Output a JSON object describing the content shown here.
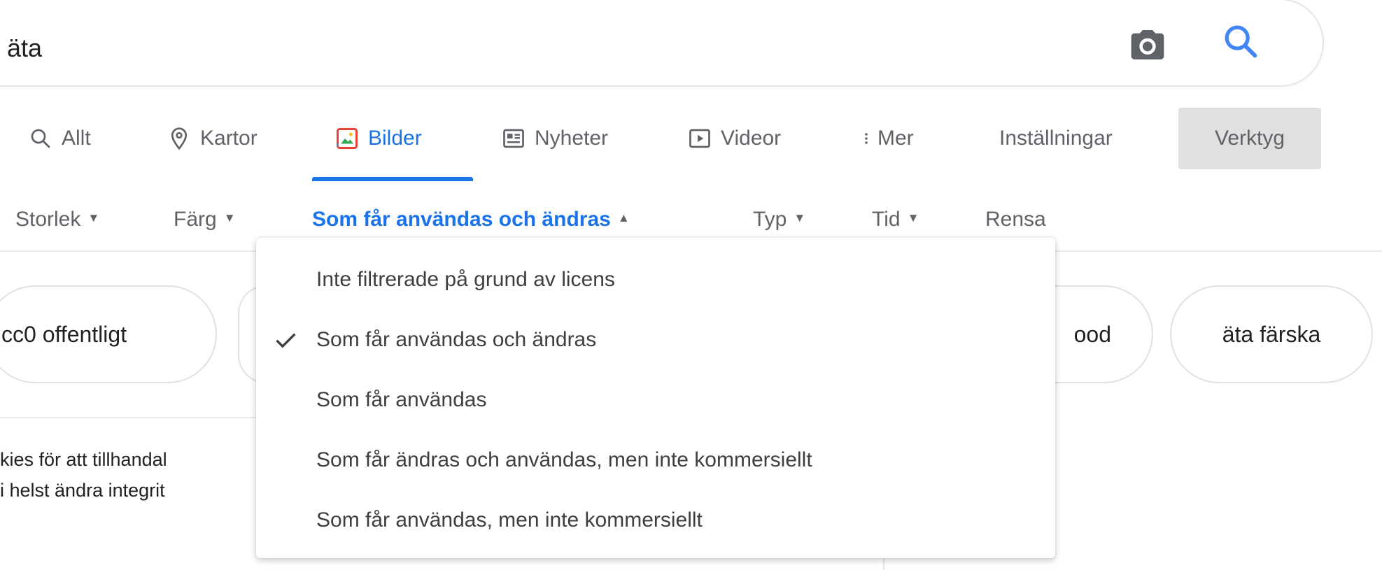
{
  "search": {
    "query": "äta"
  },
  "tabs": [
    {
      "label": "Allt",
      "icon": "search-icon"
    },
    {
      "label": "Kartor",
      "icon": "map-pin-icon"
    },
    {
      "label": "Bilder",
      "icon": "image-icon",
      "active": true
    },
    {
      "label": "Nyheter",
      "icon": "news-icon"
    },
    {
      "label": "Videor",
      "icon": "play-icon"
    },
    {
      "label": "Mer",
      "icon": "more-vert-icon"
    }
  ],
  "settings_label": "Inställningar",
  "tools_label": "Verktyg",
  "filters": [
    {
      "label": "Storlek"
    },
    {
      "label": "Färg"
    },
    {
      "label": "Som får användas och ändras",
      "active": true
    },
    {
      "label": "Typ"
    },
    {
      "label": "Tid"
    },
    {
      "label": "Rensa"
    }
  ],
  "chips": [
    "cc0 offentligt",
    "ood",
    "äta färska"
  ],
  "cookie_text": [
    "kies för att tillhandal",
    "i helst ändra integrit"
  ],
  "license_menu": {
    "options": [
      {
        "label": "Inte filtrerade på grund av licens",
        "selected": false
      },
      {
        "label": "Som får användas och ändras",
        "selected": true
      },
      {
        "label": "Som får användas",
        "selected": false
      },
      {
        "label": "Som får ändras och användas, men inte kommersiellt",
        "selected": false
      },
      {
        "label": "Som får användas, men inte kommersiellt",
        "selected": false
      }
    ]
  },
  "colors": {
    "accent": "#1a73e8",
    "text": "#3c4043",
    "muted": "#5f6368",
    "tools_bg": "#e0e0e0"
  }
}
